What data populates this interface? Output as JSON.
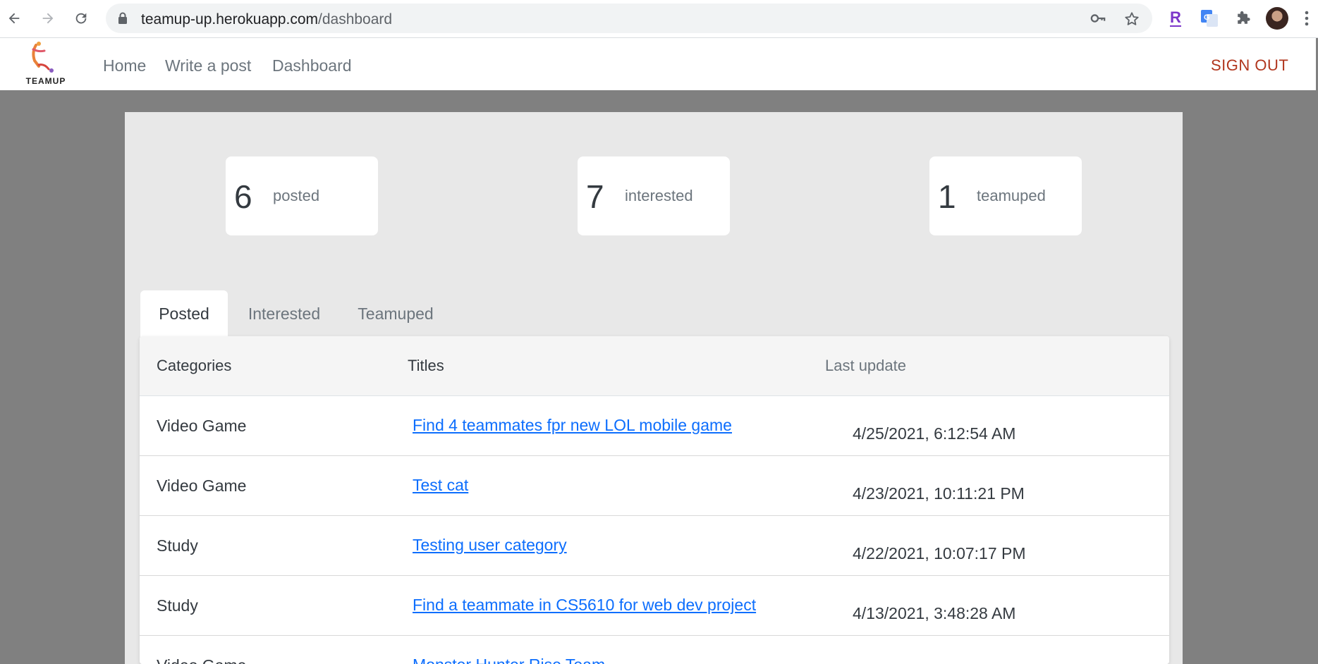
{
  "browser": {
    "url_host": "teamup-up.herokuapp.com",
    "url_path": "/dashboard"
  },
  "header": {
    "logo_text": "TEAMUP",
    "nav": [
      "Home",
      "Write a post",
      "Dashboard"
    ],
    "signout": "SIGN OUT"
  },
  "stats": [
    {
      "value": "6",
      "label": "posted"
    },
    {
      "value": "7",
      "label": "interested"
    },
    {
      "value": "1",
      "label": "teamuped"
    }
  ],
  "tabs": [
    "Posted",
    "Interested",
    "Teamuped"
  ],
  "table": {
    "headers": [
      "Categories",
      "Titles",
      "Last update"
    ],
    "rows": [
      {
        "category": "Video Game",
        "title": "Find 4 teammates fpr new LOL mobile game",
        "updated": "4/25/2021, 6:12:54 AM"
      },
      {
        "category": "Video Game",
        "title": "Test cat",
        "updated": "4/23/2021, 10:11:21 PM"
      },
      {
        "category": "Study",
        "title": "Testing user category",
        "updated": "4/22/2021, 10:07:17 PM"
      },
      {
        "category": "Study",
        "title": "Find a teammate in CS5610 for web dev project",
        "updated": "4/13/2021, 3:48:28 AM"
      },
      {
        "category": "Video Game",
        "title": "Monster Hunter Rise Team",
        "updated": ""
      }
    ]
  },
  "colors": {
    "accent": "#b1361e",
    "link": "#0d6efd",
    "backdrop": "#808080",
    "panel": "#e8e8e8"
  }
}
